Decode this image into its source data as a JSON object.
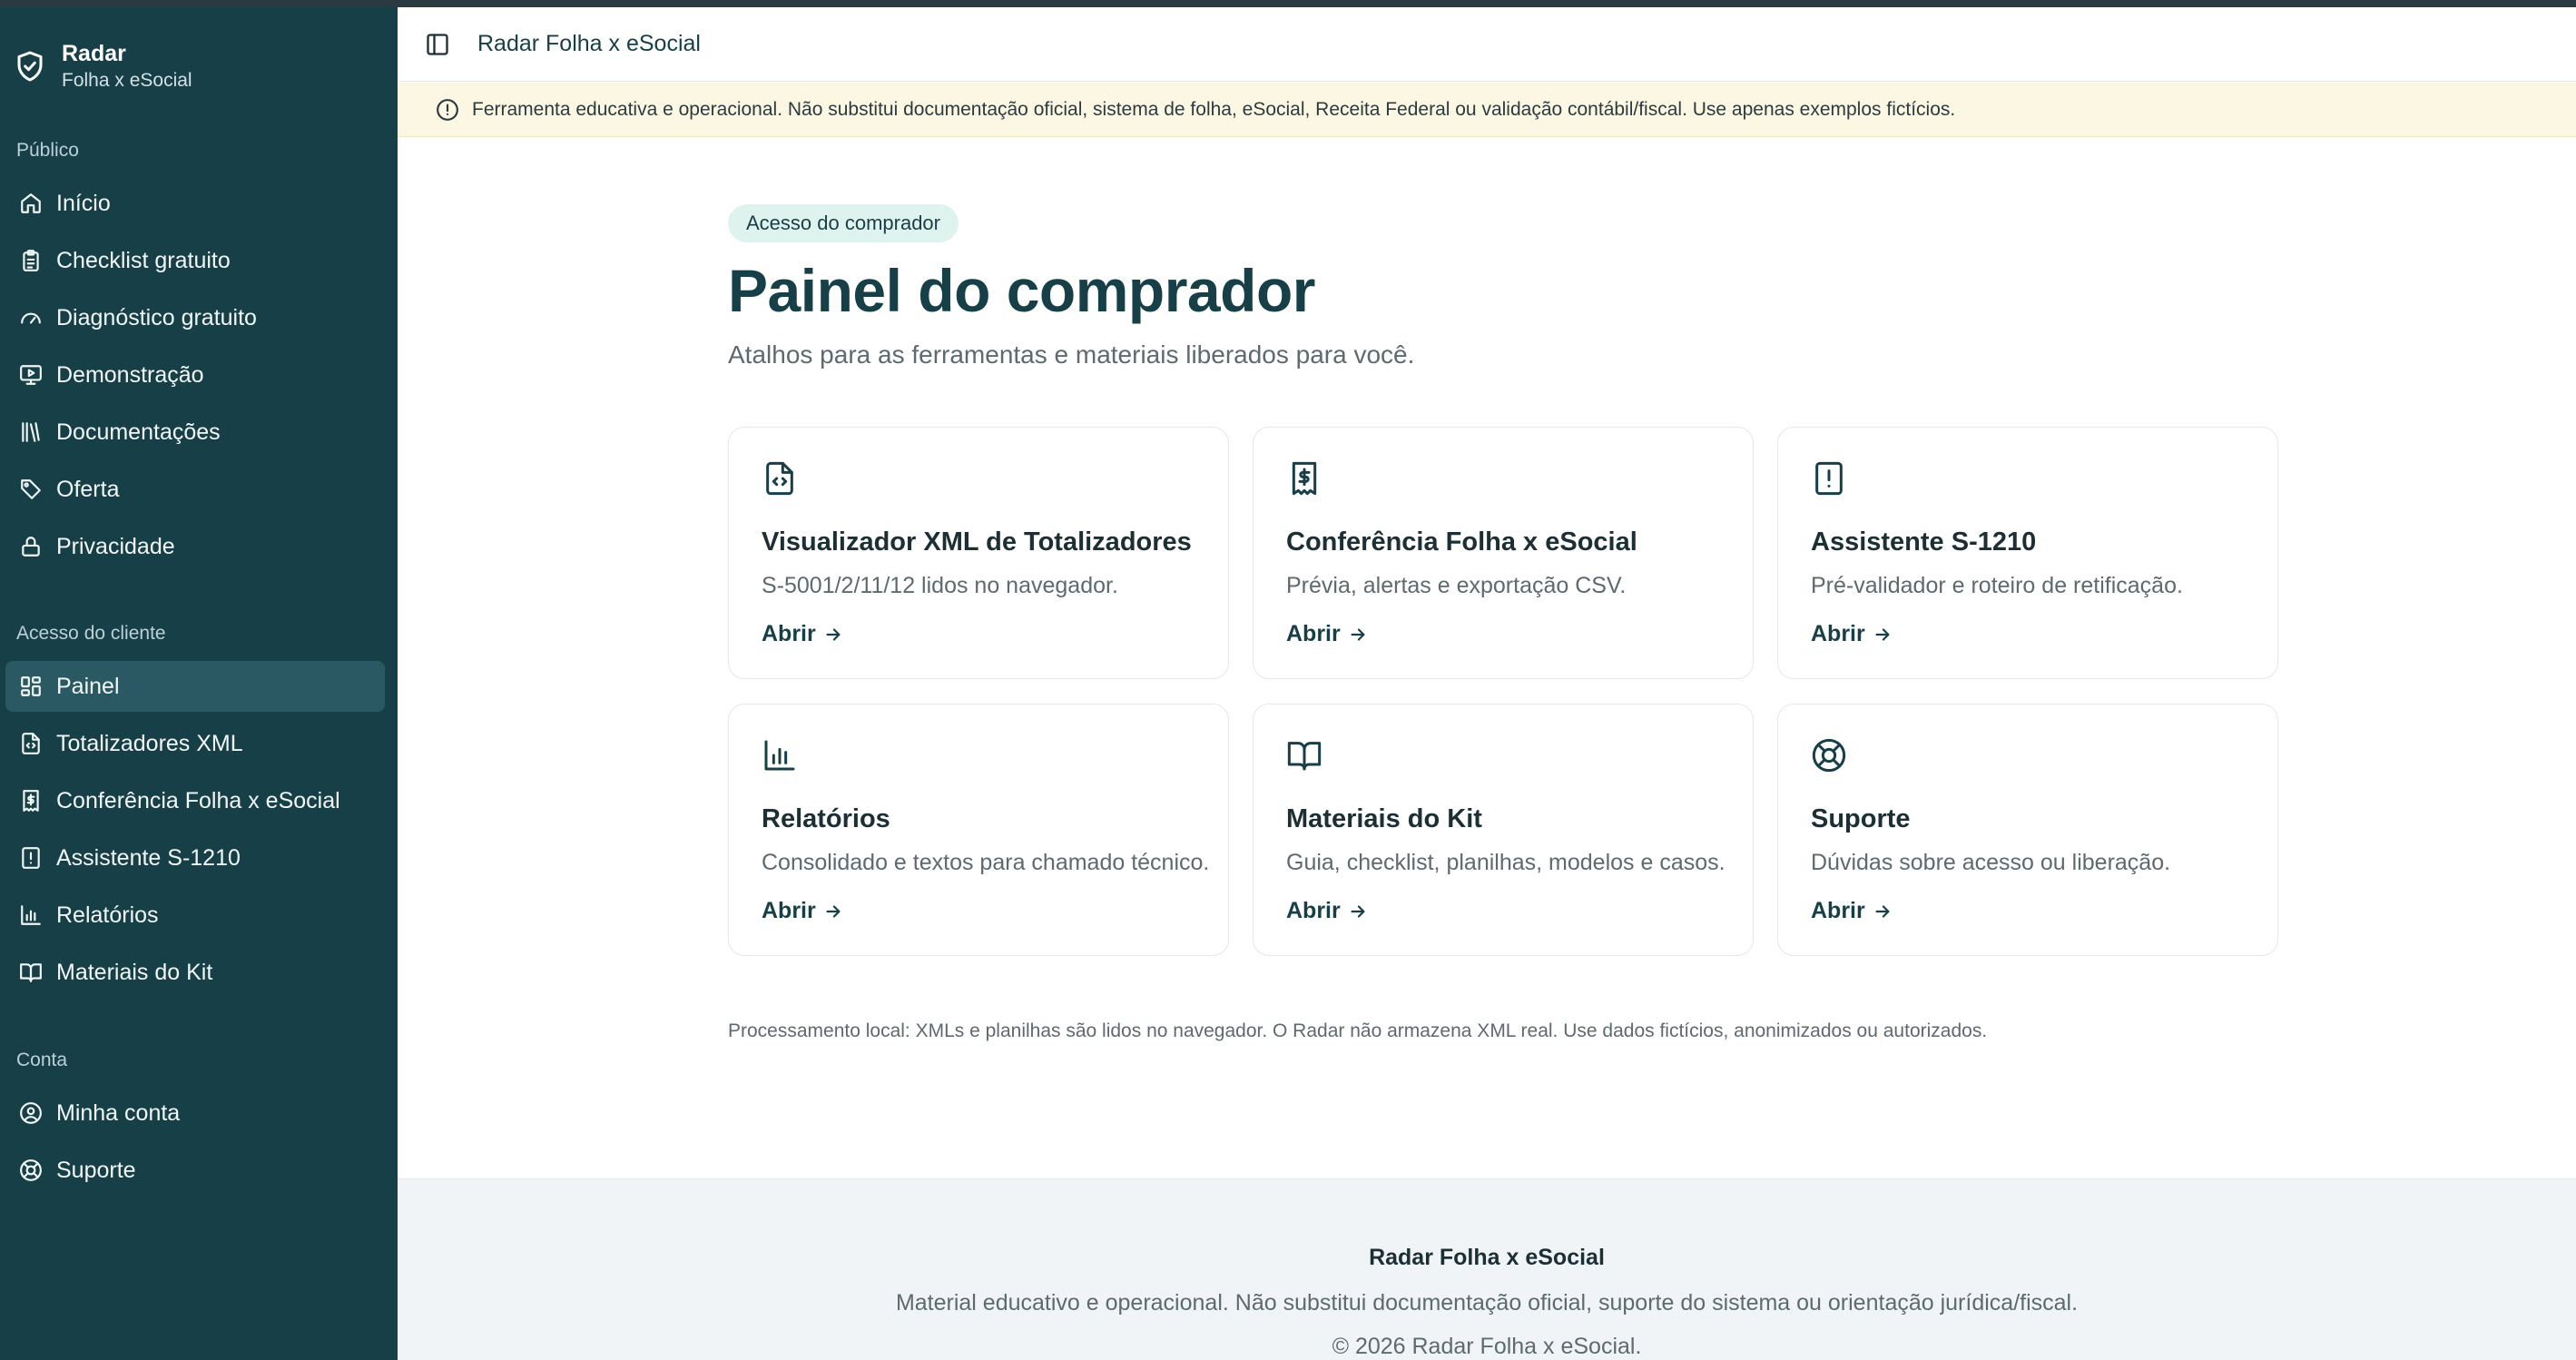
{
  "brand": {
    "title": "Radar",
    "subtitle": "Folha x eSocial",
    "icon": "shield-check-icon"
  },
  "sidebar": {
    "sections": [
      {
        "label": "Público",
        "items": [
          {
            "label": "Início",
            "icon": "home-icon"
          },
          {
            "label": "Checklist gratuito",
            "icon": "clipboard-list-icon"
          },
          {
            "label": "Diagnóstico gratuito",
            "icon": "gauge-icon"
          },
          {
            "label": "Demonstração",
            "icon": "monitor-play-icon"
          },
          {
            "label": "Documentações",
            "icon": "library-icon"
          },
          {
            "label": "Oferta",
            "icon": "tag-icon"
          },
          {
            "label": "Privacidade",
            "icon": "lock-icon"
          }
        ]
      },
      {
        "label": "Acesso do cliente",
        "items": [
          {
            "label": "Painel",
            "icon": "layout-grid-icon",
            "active": true
          },
          {
            "label": "Totalizadores XML",
            "icon": "file-code-icon"
          },
          {
            "label": "Conferência Folha x eSocial",
            "icon": "receipt-dollar-icon"
          },
          {
            "label": "Assistente S-1210",
            "icon": "file-alert-icon"
          },
          {
            "label": "Relatórios",
            "icon": "bar-chart-icon"
          },
          {
            "label": "Materiais do Kit",
            "icon": "book-open-icon"
          }
        ]
      },
      {
        "label": "Conta",
        "items": [
          {
            "label": "Minha conta",
            "icon": "user-circle-icon"
          },
          {
            "label": "Suporte",
            "icon": "life-buoy-icon"
          }
        ]
      }
    ]
  },
  "header": {
    "title": "Radar Folha x eSocial",
    "toggle_icon": "sidebar-toggle-icon"
  },
  "notice": {
    "text": "Ferramenta educativa e operacional. Não substitui documentação oficial, sistema de folha, eSocial, Receita Federal ou validação contábil/fiscal. Use apenas exemplos fictícios.",
    "icon": "alert-circle-icon"
  },
  "main": {
    "badge": "Acesso do comprador",
    "title": "Painel do comprador",
    "subtitle": "Atalhos para as ferramentas e materiais liberados para você.",
    "cards": [
      {
        "title": "Visualizador XML de Totalizadores",
        "description": "S-5001/2/11/12 lidos no navegador.",
        "link": "Abrir",
        "icon": "file-code-icon"
      },
      {
        "title": "Conferência Folha x eSocial",
        "description": "Prévia, alertas e exportação CSV.",
        "link": "Abrir",
        "icon": "receipt-dollar-icon"
      },
      {
        "title": "Assistente S-1210",
        "description": "Pré-validador e roteiro de retificação.",
        "link": "Abrir",
        "icon": "file-alert-icon"
      },
      {
        "title": "Relatórios",
        "description": "Consolidado e textos para chamado técnico.",
        "link": "Abrir",
        "icon": "bar-chart-icon"
      },
      {
        "title": "Materiais do Kit",
        "description": "Guia, checklist, planilhas, modelos e casos.",
        "link": "Abrir",
        "icon": "book-open-icon"
      },
      {
        "title": "Suporte",
        "description": "Dúvidas sobre acesso ou liberação.",
        "link": "Abrir",
        "icon": "life-buoy-icon"
      }
    ],
    "footnote": "Processamento local: XMLs e planilhas são lidos no navegador. O Radar não armazena XML real. Use dados fictícios, anonimizados ou autorizados."
  },
  "footer": {
    "title": "Radar Folha x eSocial",
    "disclaimer": "Material educativo e operacional. Não substitui documentação oficial, suporte do sistema ou orientação jurídica/fiscal.",
    "copyright": "© 2026 Radar Folha x eSocial."
  },
  "colors": {
    "sidebar_bg": "#173f48",
    "active_bg": "#2a5863",
    "notice_bg": "#fcf7e3",
    "badge_bg": "#dff3ee",
    "footer_bg": "#f1f4f6"
  }
}
